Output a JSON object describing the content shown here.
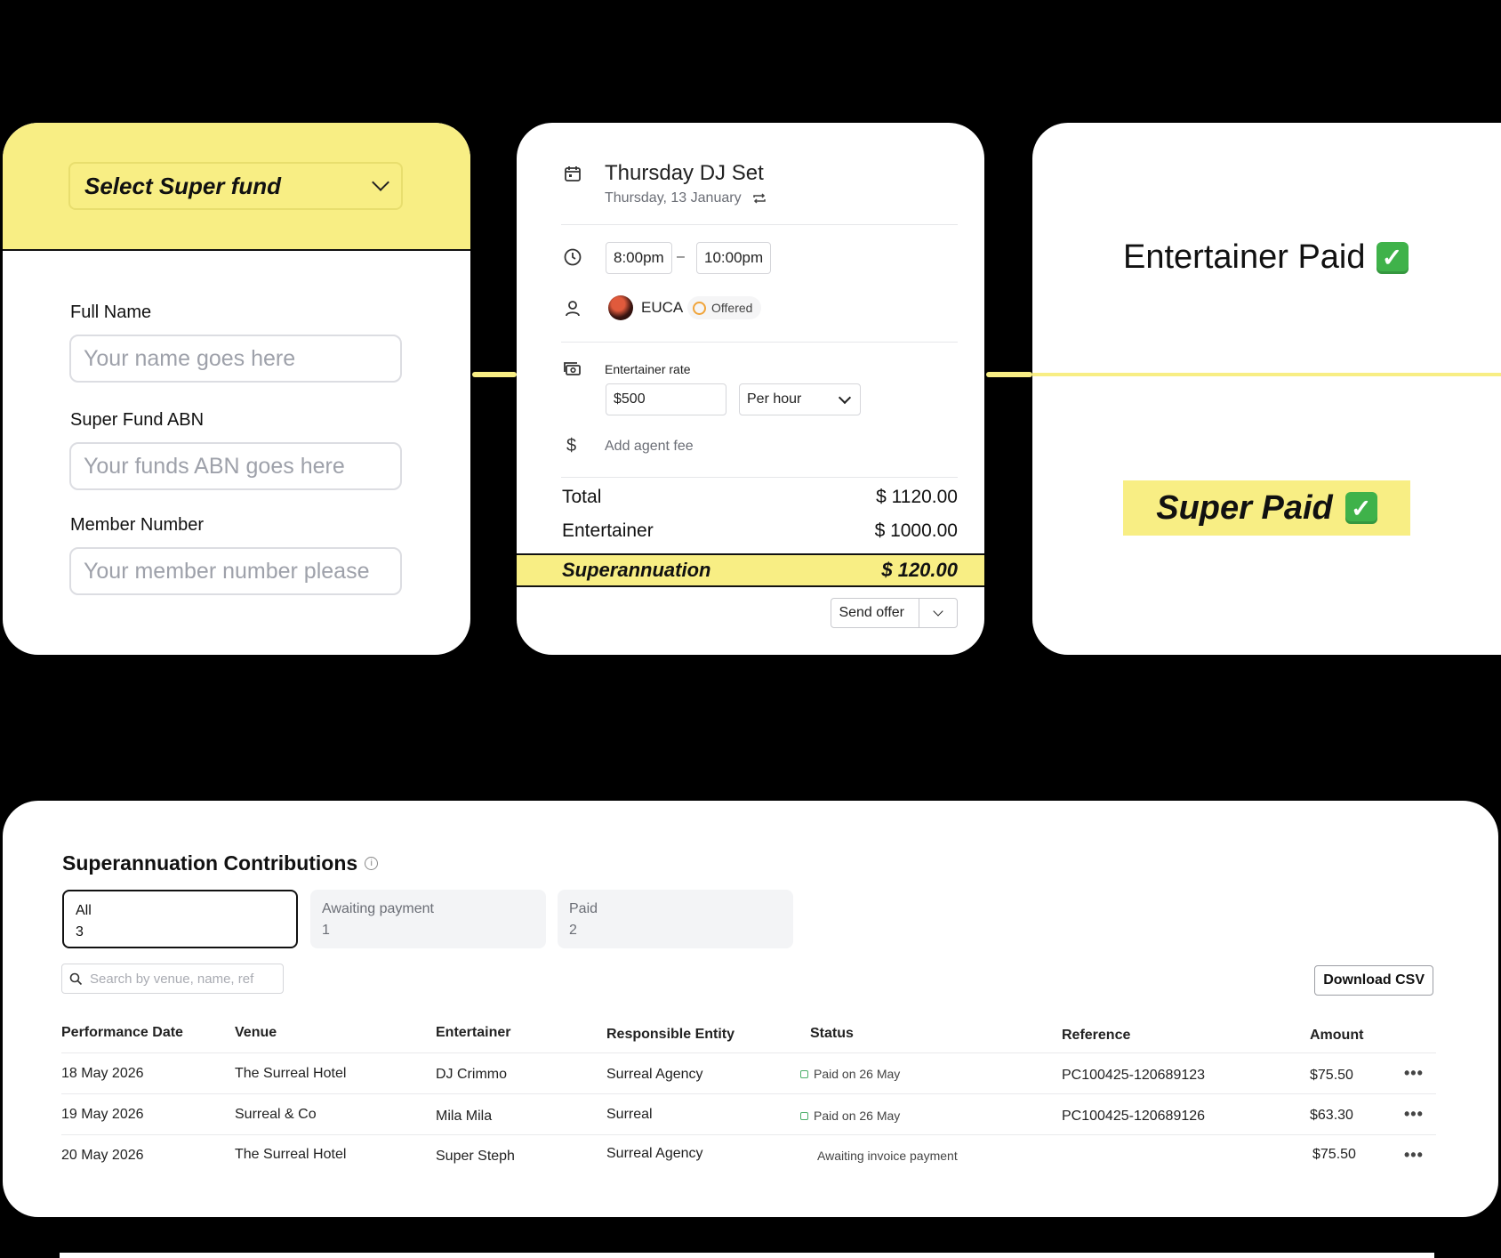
{
  "form_card": {
    "fund_select_label": "Select Super fund",
    "fields": [
      {
        "label": "Full Name",
        "placeholder": "Your name goes here"
      },
      {
        "label": "Super Fund ABN",
        "placeholder": "Your funds ABN goes here"
      },
      {
        "label": "Member Number",
        "placeholder": "Your member number please"
      }
    ]
  },
  "gig_card": {
    "title": "Thursday DJ Set",
    "date": "Thursday, 13 January",
    "start_time": "8:00pm",
    "dash": "–",
    "end_time": "10:00pm",
    "entertainer": "EUCA",
    "offer_status": "Offered",
    "rate_label": "Entertainer rate",
    "rate_value": "$500",
    "rate_unit": "Per hour",
    "dollar_icon": "$",
    "agent_fee": "Add agent fee",
    "total_label": "Total",
    "total_value": "$ 1120.00",
    "entertainer_label": "Entertainer",
    "entertainer_value": "$ 1000.00",
    "super_label": "Superannuation",
    "super_value": "$ 120.00",
    "send_label": "Send offer"
  },
  "paid_card": {
    "entertainer_paid": "Entertainer Paid",
    "super_paid": "Super Paid",
    "check_glyph": "✓"
  },
  "contributions": {
    "title": "Superannuation Contributions",
    "info_glyph": "i",
    "tabs": [
      {
        "label": "All",
        "count": "3"
      },
      {
        "label": "Awaiting payment",
        "count": "1"
      },
      {
        "label": "Paid",
        "count": "2"
      }
    ],
    "search_placeholder": "Search by venue, name, ref",
    "download_label": "Download CSV",
    "columns": [
      "Performance Date",
      "Venue",
      "Entertainer",
      "Responsible Entity",
      "Status",
      "Reference",
      "Amount"
    ],
    "more_glyph": "•••",
    "rows": [
      {
        "date": "18 May 2026",
        "venue": "The Surreal Hotel",
        "entertainer": "DJ Crimmo",
        "entity": "Surreal Agency",
        "status": "Paid on 26 May",
        "reference": "PC100425-120689123",
        "amount": "$75.50"
      },
      {
        "date": "19 May 2026",
        "venue": "Surreal & Co",
        "entertainer": "Mila Mila",
        "entity": "Surreal",
        "status": "Paid on 26 May",
        "reference": "PC100425-120689126",
        "amount": "$63.30"
      },
      {
        "date": "20 May 2026",
        "venue": "The Surreal Hotel",
        "entertainer": "Super Steph",
        "entity": "Surreal Agency",
        "status": "Awaiting invoice payment",
        "reference": "",
        "amount": "$75.50"
      }
    ]
  },
  "colors": {
    "accent_yellow": "#f8ee84",
    "background": "#000000",
    "check_green": "#3fb24a",
    "offered_ring": "#f0a43a"
  }
}
